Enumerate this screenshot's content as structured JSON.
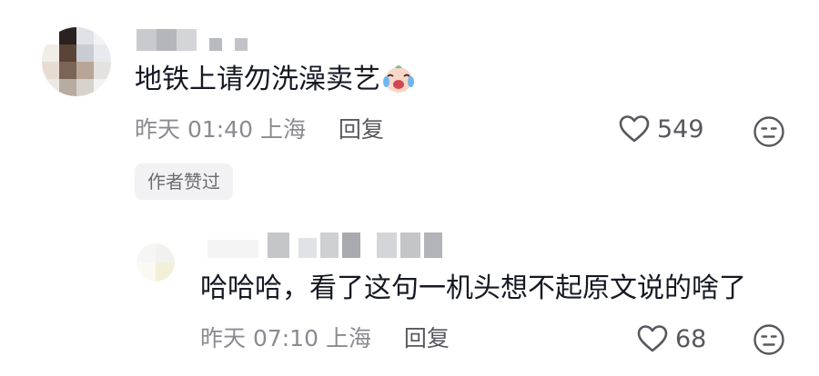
{
  "comment": {
    "text": "地铁上请勿洗澡卖艺",
    "emoji": "crying-laughing-face-emoji",
    "time": "昨天 01:40",
    "location": "上海",
    "reply_label": "回复",
    "likes": "549",
    "author_tag": "作者赞过"
  },
  "reply": {
    "text": "哈哈哈，看了这句一机头想不起原文说的啥了",
    "time": "昨天 07:10",
    "location": "上海",
    "reply_label": "回复",
    "likes": "68"
  },
  "colors": {
    "text_primary": "#161823",
    "text_secondary": "#8a8b91",
    "icon": "#57585f",
    "tag_bg": "#f2f2f4"
  },
  "icons": {
    "like": "heart-outline-icon",
    "dislike": "neutral-face-icon"
  }
}
